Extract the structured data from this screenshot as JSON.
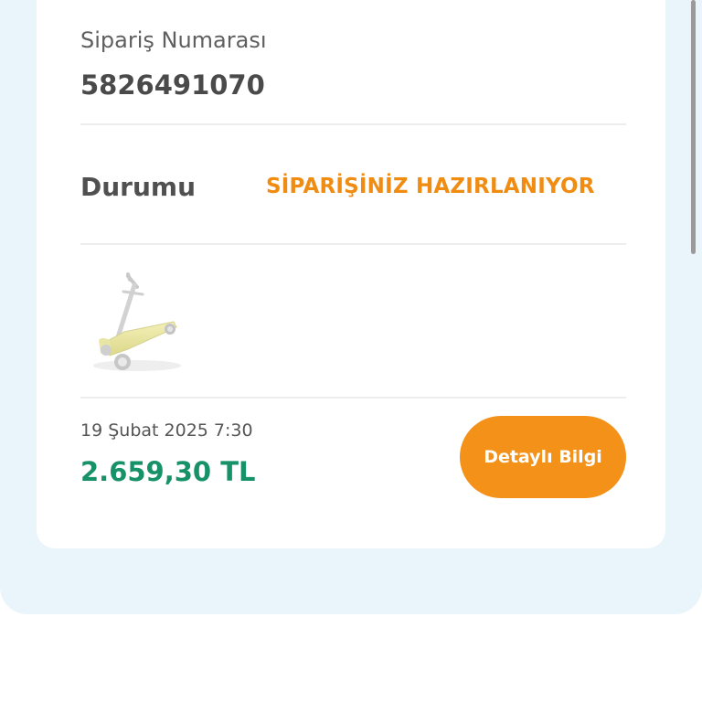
{
  "order": {
    "number_label": "Sipariş Numarası",
    "number_value": "5826491070",
    "status_label": "Durumu",
    "status_value": "SİPARİŞİNİZ HAZIRLANIYOR",
    "date": "19 Şubat 2025 7:30",
    "total": "2.659,30 TL",
    "details_button_label": "Detaylı Bilgi",
    "product_image": "kick-scooter-image"
  },
  "colors": {
    "status": "#f08c12",
    "total": "#179167",
    "button": "#f39118",
    "panel_background": "#eaf4fb"
  }
}
